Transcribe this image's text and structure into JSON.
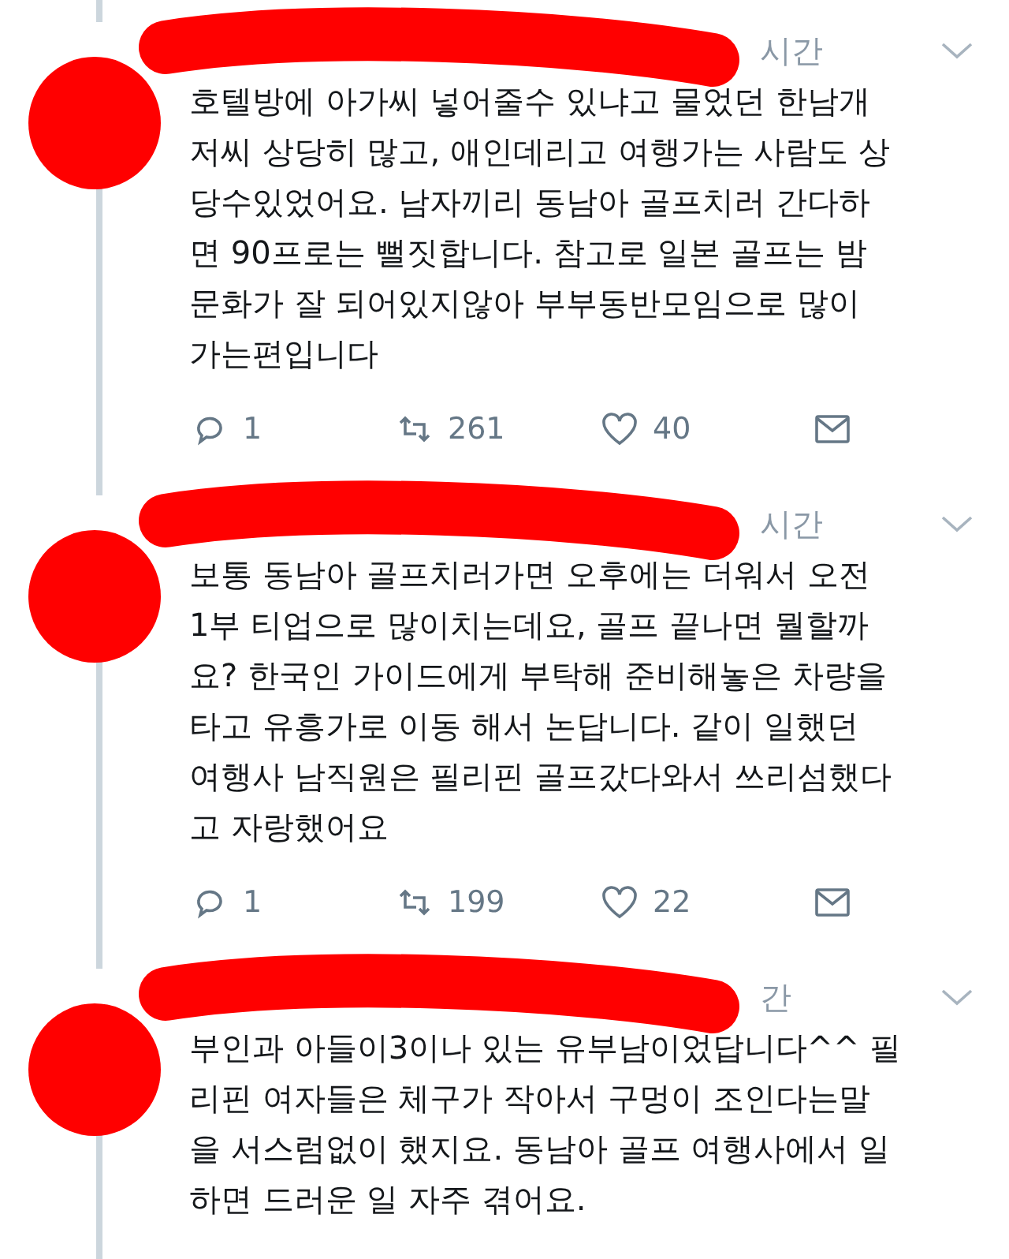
{
  "tweets": [
    {
      "time": "시간",
      "text": "호텔방에 아가씨 넣어줄수 있냐고 물었던 한남개\n저씨 상당히 많고, 애인데리고 여행가는 사람도 상\n당수있었어요. 남자끼리 동남아 골프치러 간다하\n면 90프로는 뻘짓합니다. 참고로 일본 골프는 밤\n문화가 잘 되어있지않아 부부동반모임으로 많이\n가는편입니다",
      "replies": "1",
      "retweets": "261",
      "likes": "40"
    },
    {
      "time": "시간",
      "text": "보통 동남아 골프치러가면 오후에는 더워서 오전\n1부 티업으로 많이치는데요, 골프 끝나면 뭘할까\n요? 한국인 가이드에게 부탁해 준비해놓은 차량을\n타고 유흥가로 이동 해서 논답니다. 같이 일했던\n여행사 남직원은 필리핀 골프갔다와서 쓰리섬했다\n고 자랑했어요",
      "replies": "1",
      "retweets": "199",
      "likes": "22"
    },
    {
      "time": "간",
      "text": "부인과 아들이3이나 있는 유부남이었답니다^^ 필\n리핀 여자들은 체구가 작아서 구멍이 조인다는말\n을 서스럼없이 했지요. 동남아 골프 여행사에서 일\n하면 드러운 일 자주 겪어요."
    }
  ]
}
